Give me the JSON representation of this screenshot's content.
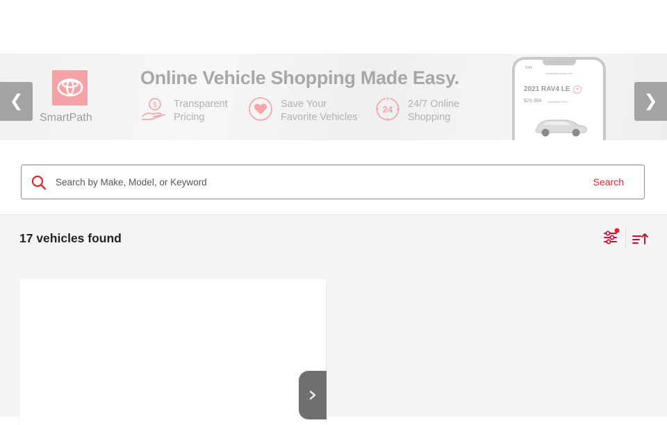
{
  "banner": {
    "prev_label": "❮",
    "next_label": "❯",
    "brand_name": "SmartPath",
    "headline": "Online Vehicle Shopping Made Easy.",
    "features": [
      {
        "line1": "Transparent",
        "line2": "Pricing",
        "icon": "hand-dollar-icon"
      },
      {
        "line1": "Save Your",
        "line2": "Favorite Vehicles",
        "icon": "heart-icon"
      },
      {
        "line1": "24/7 Online",
        "line2": "Shopping",
        "icon": "clock-24-icon"
      }
    ],
    "phone": {
      "time": "9:41",
      "site": "smartpath.toyota.com",
      "model": "2021 RAV4 LE",
      "price": "$29,384",
      "price_note": "Advertised Price"
    },
    "colors": {
      "accent": "#f5a3a7",
      "text": "#a7a7a7"
    }
  },
  "search": {
    "placeholder": "Search by Make, Model, or Keyword",
    "value": "",
    "button_label": "Search",
    "accent": "#e8212e"
  },
  "results": {
    "count_text": "17 vehicles found"
  }
}
